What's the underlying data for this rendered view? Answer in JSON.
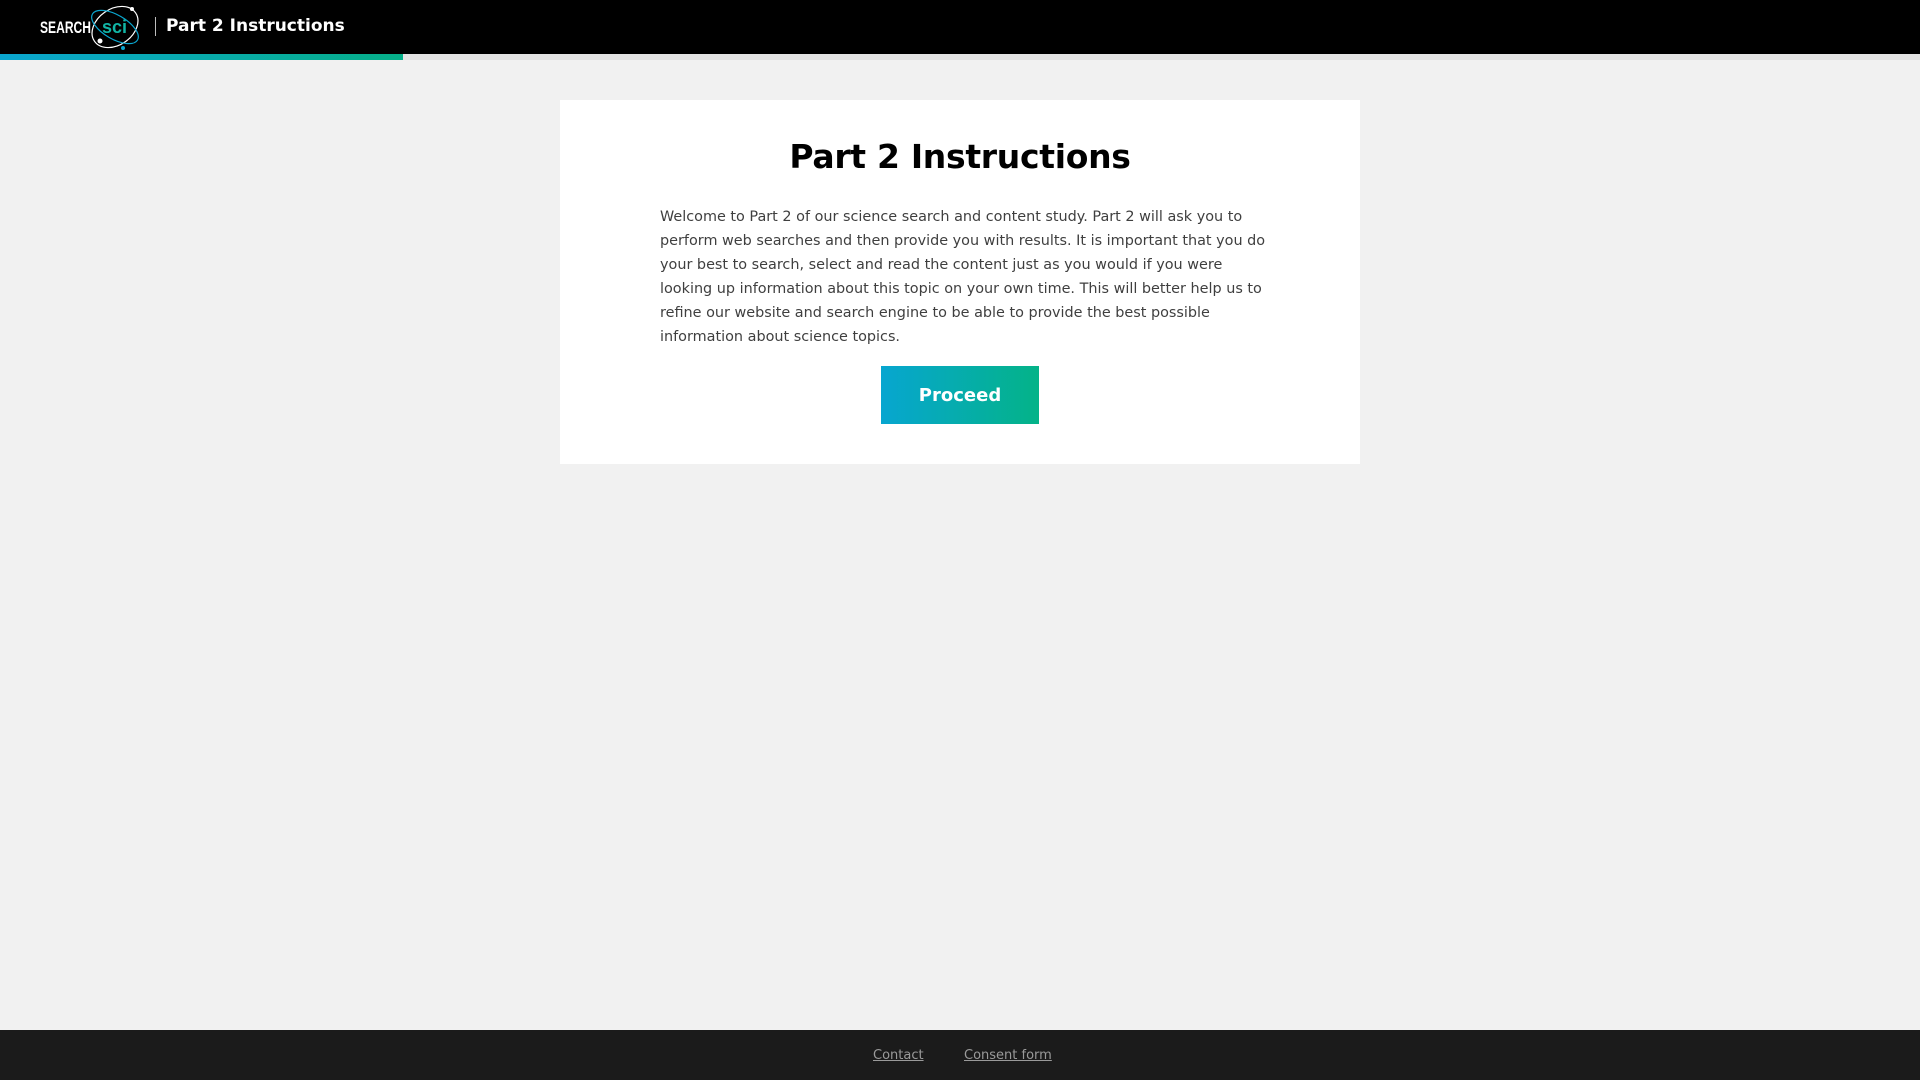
{
  "header": {
    "logo": {
      "text_search": "SEARCH",
      "text_sci": "sci"
    },
    "title": "Part 2 Instructions"
  },
  "progress": {
    "fraction": 0.21
  },
  "main": {
    "title": "Part 2 Instructions",
    "body": "Welcome to Part 2 of our science search and content study. Part 2 will ask you to perform web searches and then provide you with results. It is important that you do your best to search, select and read the content just as you would if you were looking up information about this topic on your own time. This will better help us to refine our website and search engine to be able to provide the best possible information about science topics.",
    "proceed_label": "Proceed"
  },
  "footer": {
    "contact_label": "Contact",
    "consent_label": "Consent form"
  },
  "colors": {
    "header_bg": "#000000",
    "page_bg": "#f1f1f1",
    "accent_start": "#07a6d0",
    "accent_end": "#04b388",
    "footer_bg": "#1b1b1b"
  }
}
